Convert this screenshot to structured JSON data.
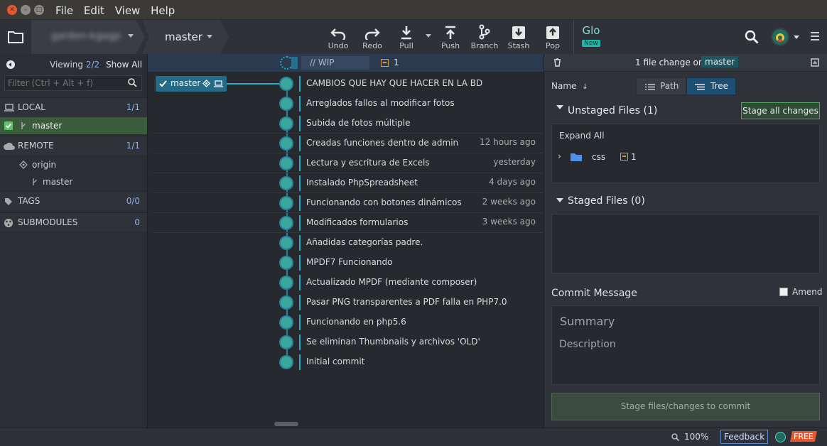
{
  "window": {
    "menu": [
      "File",
      "Edit",
      "View",
      "Help"
    ]
  },
  "toolbar": {
    "repo_name": "garden-kgagp",
    "branch": "master",
    "buttons": [
      {
        "label": "Undo",
        "icon": "undo-icon"
      },
      {
        "label": "Redo",
        "icon": "redo-icon"
      },
      {
        "label": "Pull",
        "icon": "pull-icon"
      },
      {
        "label": "Push",
        "icon": "push-icon"
      },
      {
        "label": "Branch",
        "icon": "branch-icon"
      },
      {
        "label": "Stash",
        "icon": "stash-icon"
      },
      {
        "label": "Pop",
        "icon": "pop-icon"
      }
    ],
    "glo_label": "Glo",
    "glo_badge": "New"
  },
  "left": {
    "viewing_label": "Viewing",
    "viewing_count": "2/2",
    "show_all": "Show All",
    "filter_placeholder": "Filter (Ctrl + Alt + f)",
    "local": {
      "label": "LOCAL",
      "count": "1/1",
      "branches": [
        "master"
      ]
    },
    "remote": {
      "label": "REMOTE",
      "count": "1/1",
      "origin": "origin",
      "branch": "master"
    },
    "tags": {
      "label": "TAGS",
      "count": "0/0"
    },
    "submodules": {
      "label": "SUBMODULES",
      "count": "0"
    }
  },
  "graph": {
    "branch_tag": "master",
    "wip_label": "// WIP",
    "wip_count": "1",
    "commits": [
      {
        "message": "CAMBIOS QUE HAY QUE HACER EN LA BD",
        "time": ""
      },
      {
        "message": "Arreglados fallos al modificar fotos",
        "time": ""
      },
      {
        "message": "Subida de fotos múltiple",
        "time": ""
      },
      {
        "message": "Creadas funciones dentro de admin",
        "time": "12 hours ago"
      },
      {
        "message": "Lectura y escritura de Excels",
        "time": "yesterday"
      },
      {
        "message": "Instalado PhpSpreadsheet",
        "time": "4 days ago"
      },
      {
        "message": "Funcionando con botones dinámicos",
        "time": "2 weeks ago"
      },
      {
        "message": "Modificados formularios",
        "time": "3 weeks ago"
      },
      {
        "message": "Añadidas categorías padre.",
        "time": ""
      },
      {
        "message": "MPDF7 Funcionando",
        "time": ""
      },
      {
        "message": "Actualizado MPDF (mediante composer)",
        "time": ""
      },
      {
        "message": "Pasar PNG transparentes a PDF falla en PHP7.0",
        "time": ""
      },
      {
        "message": "Funcionando en php5.6",
        "time": ""
      },
      {
        "message": "Se eliminan Thumbnails y archivos 'OLD'",
        "time": ""
      },
      {
        "message": "Initial commit",
        "time": ""
      }
    ]
  },
  "right": {
    "header_text": "1 file change on",
    "header_branch": "master",
    "sort_label": "Name",
    "path_label": "Path",
    "tree_label": "Tree",
    "unstaged_label": "Unstaged Files (1)",
    "stage_all": "Stage all changes",
    "expand_all": "Expand All",
    "folder_name": "css",
    "folder_count": "1",
    "staged_label": "Staged Files (0)",
    "commit_message_label": "Commit Message",
    "amend_label": "Amend",
    "summary_placeholder": "Summary",
    "description_placeholder": "Description",
    "commit_button": "Stage files/changes to commit"
  },
  "status": {
    "zoom": "100%",
    "feedback": "Feedback",
    "free": "FREE"
  }
}
